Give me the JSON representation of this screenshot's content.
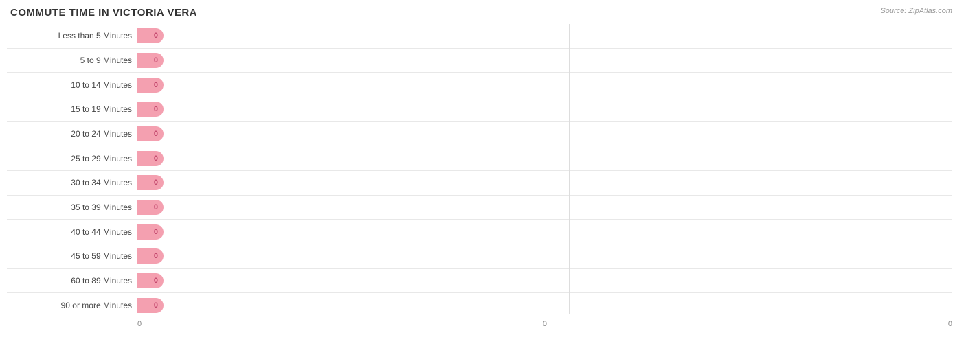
{
  "title": "COMMUTE TIME IN VICTORIA VERA",
  "source": "Source: ZipAtlas.com",
  "bars": [
    {
      "label": "Less than 5 Minutes",
      "value": 0,
      "display": "0"
    },
    {
      "label": "5 to 9 Minutes",
      "value": 0,
      "display": "0"
    },
    {
      "label": "10 to 14 Minutes",
      "value": 0,
      "display": "0"
    },
    {
      "label": "15 to 19 Minutes",
      "value": 0,
      "display": "0"
    },
    {
      "label": "20 to 24 Minutes",
      "value": 0,
      "display": "0"
    },
    {
      "label": "25 to 29 Minutes",
      "value": 0,
      "display": "0"
    },
    {
      "label": "30 to 34 Minutes",
      "value": 0,
      "display": "0"
    },
    {
      "label": "35 to 39 Minutes",
      "value": 0,
      "display": "0"
    },
    {
      "label": "40 to 44 Minutes",
      "value": 0,
      "display": "0"
    },
    {
      "label": "45 to 59 Minutes",
      "value": 0,
      "display": "0"
    },
    {
      "label": "60 to 89 Minutes",
      "value": 0,
      "display": "0"
    },
    {
      "label": "90 or more Minutes",
      "value": 0,
      "display": "0"
    }
  ],
  "x_axis": {
    "ticks": [
      "0",
      "0",
      "0"
    ]
  },
  "colors": {
    "bar_fill": "#f4a0b0",
    "bar_text": "#c0436a",
    "grid_line": "#dddddd",
    "title": "#333333",
    "source": "#999999"
  }
}
